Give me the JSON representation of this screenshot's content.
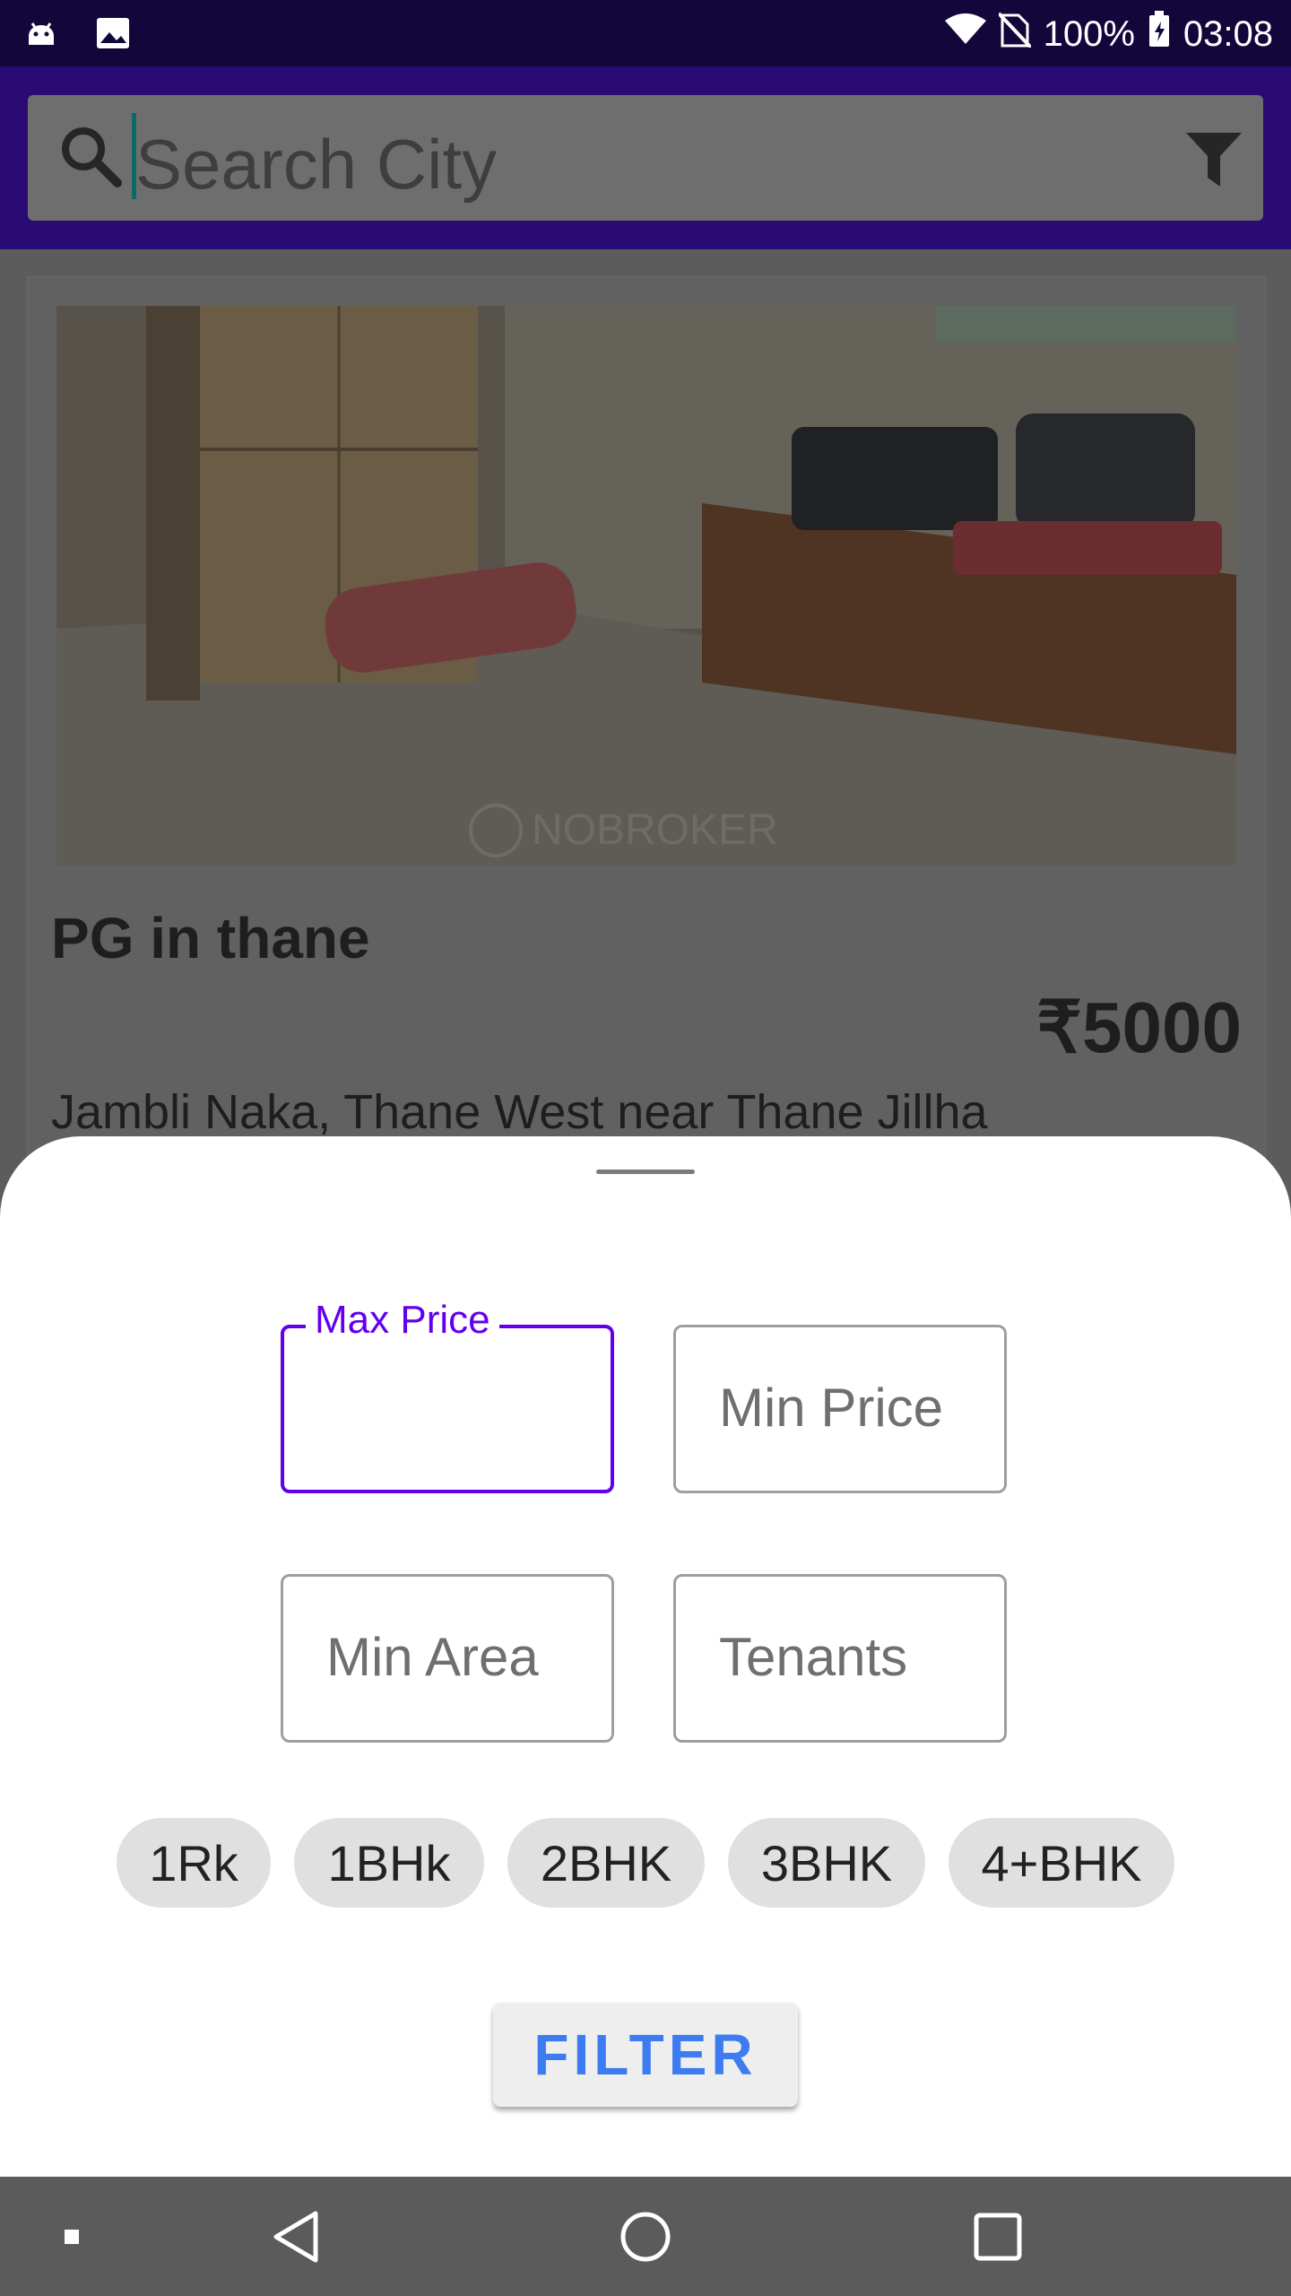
{
  "status_bar": {
    "battery": "100%",
    "time": "03:08",
    "icons": [
      "android-debug-icon",
      "image-icon",
      "wifi-icon",
      "no-sim-icon",
      "battery-charging-icon"
    ]
  },
  "search": {
    "placeholder": "Search City",
    "icon": "search-icon",
    "filter_icon": "filter-funnel-icon"
  },
  "listing": {
    "title": "PG in thane",
    "price": "₹5000",
    "address": "Jambli Naka, Thane West near Thane Jillha",
    "photo_watermark": "NOBROKER"
  },
  "filter_sheet": {
    "fields": {
      "max_price": "Max Price",
      "min_price": "Min Price",
      "min_area": "Min Area",
      "tenants": "Tenants"
    },
    "chips": [
      "1Rk",
      "1BHk",
      "2BHK",
      "3BHK",
      "4+BHK"
    ],
    "filter_button": "FILTER"
  },
  "nav": {
    "items": [
      "square-small-icon",
      "back-triangle-icon",
      "home-circle-icon",
      "recents-square-icon"
    ]
  },
  "colors": {
    "accent": "#6200ee",
    "button_text": "#3d7cf0",
    "toolbar": "#2a0a73",
    "status_bar": "#12063a"
  }
}
